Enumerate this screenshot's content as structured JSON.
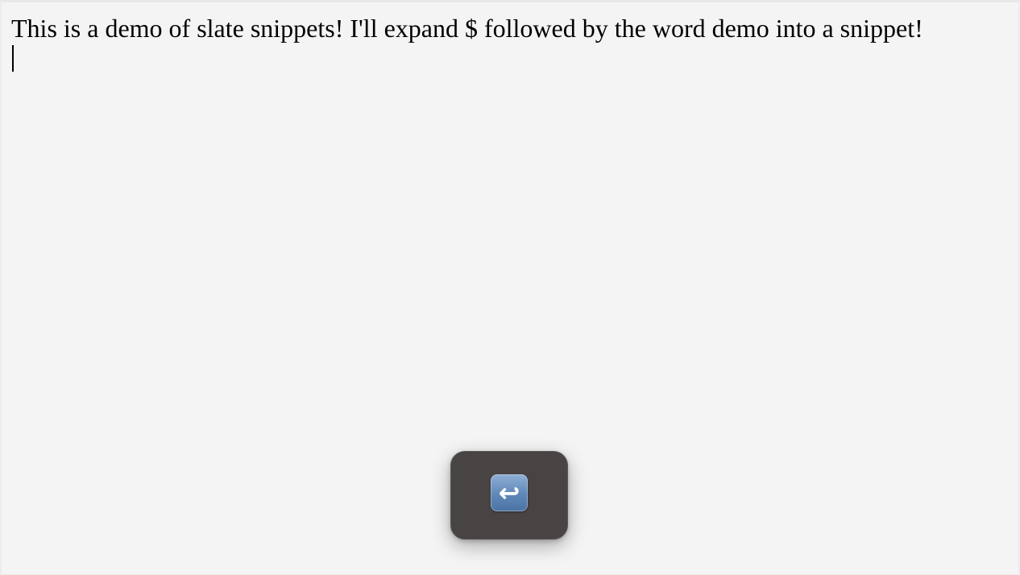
{
  "editor": {
    "paragraph_text": "This is a demo of slate snippets! I'll expand $ followed by the word demo into a snippet!"
  },
  "overlay": {
    "key_icon_name": "return-key-icon",
    "key_glyph": "↩"
  },
  "colors": {
    "background": "#f4f4f4",
    "overlay_background": "#494444",
    "key_icon_blue": "#5e87b8"
  }
}
